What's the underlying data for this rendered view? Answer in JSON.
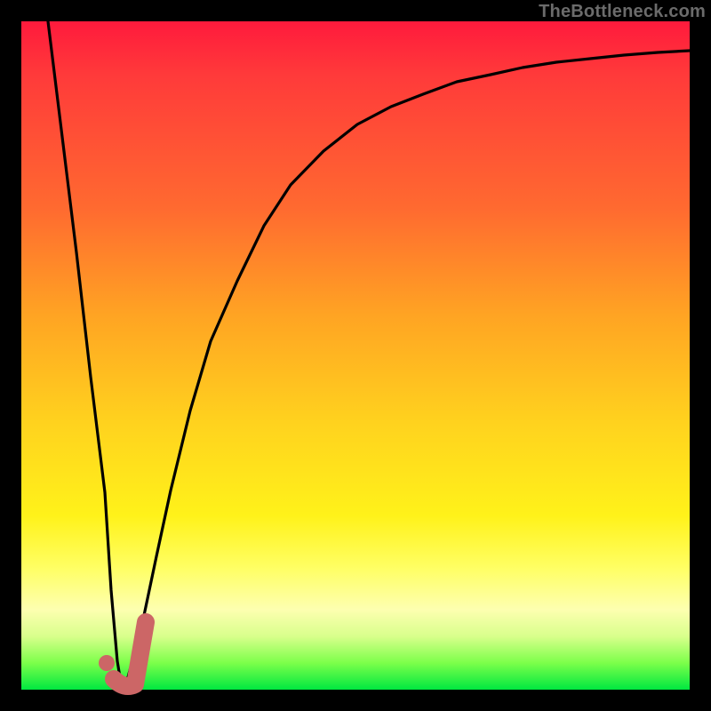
{
  "watermark": "TheBottleneck.com",
  "colors": {
    "background": "#000000",
    "curve": "#000000",
    "marker": "#cc6666",
    "gradient_top": "#ff1a3c",
    "gradient_bottom": "#00e840"
  },
  "chart_data": {
    "type": "line",
    "title": "",
    "xlabel": "",
    "ylabel": "",
    "xlim": [
      0,
      100
    ],
    "ylim": [
      0,
      100
    ],
    "grid": false,
    "legend": false,
    "series": [
      {
        "name": "bottleneck-curve",
        "x": [
          4,
          6,
          8,
          10,
          12,
          13,
          14,
          15,
          16,
          18,
          20,
          22,
          25,
          28,
          32,
          36,
          40,
          45,
          50,
          55,
          60,
          65,
          70,
          75,
          80,
          85,
          90,
          95,
          100
        ],
        "y": [
          100,
          82,
          64,
          46,
          28,
          14,
          4,
          0,
          2,
          10,
          20,
          30,
          42,
          52,
          62,
          70,
          76,
          81,
          85,
          87.5,
          89.5,
          91,
          92.2,
          93.2,
          94,
          94.6,
          95.1,
          95.5,
          95.8
        ]
      }
    ],
    "annotations": [
      {
        "name": "optimum-marker",
        "shape": "J-hook",
        "approx_x_range": [
          13,
          18
        ],
        "approx_y_range": [
          0,
          10
        ],
        "color": "#cc6666"
      }
    ]
  }
}
